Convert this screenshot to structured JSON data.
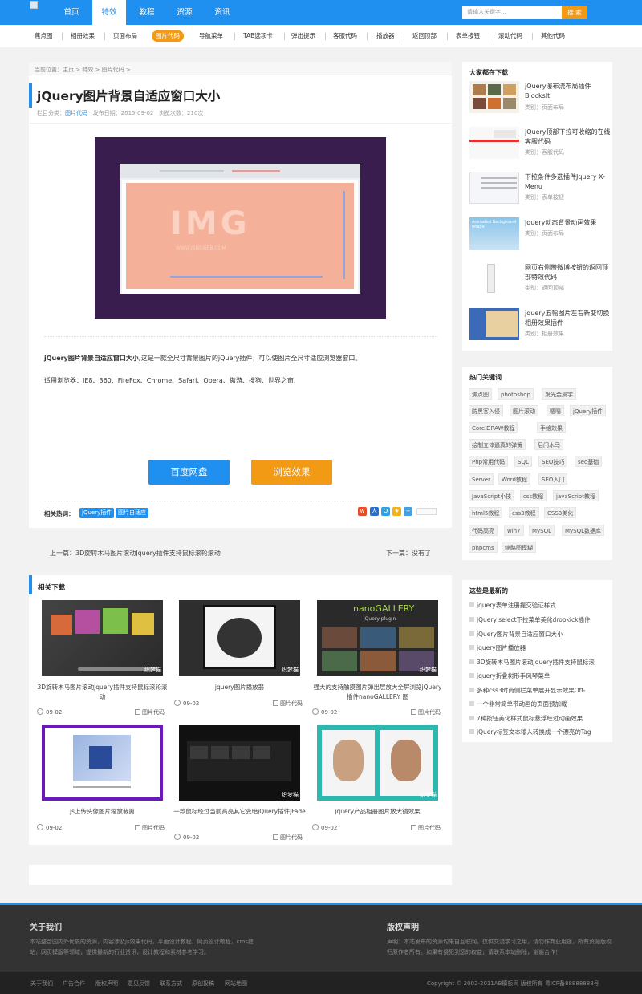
{
  "nav": {
    "items": [
      "首页",
      "特效",
      "教程",
      "资源",
      "资讯"
    ],
    "active": "特效"
  },
  "search": {
    "placeholder": "请输入关键字...",
    "button": "搜 索"
  },
  "subnav": [
    "焦点图",
    "相册效果",
    "页面布局",
    "图片代码",
    "导航菜单",
    "TAB选项卡",
    "弹出提示",
    "客服代码",
    "播放器",
    "返回顶部",
    "表单按钮",
    "滚动代码",
    "其他代码"
  ],
  "breadcrumb": "当前位置：主页 > 特效 > 图片代码 >",
  "article": {
    "title": "jQuery图片背景自适应窗口大小",
    "meta_prefix": "栏目分类：",
    "meta_category": "图片代码",
    "meta_date": "发布日期：2015-09-02",
    "meta_views": "浏览次数：210次",
    "image_text": "IMG",
    "image_sub": "WWW.JSNEWEB.COM",
    "lead_bold": "jQuery图片背景自适应窗口大小,",
    "lead_rest": "这是一款全尺寸背景图片的jQuery插件，可以使图片全尺寸适应浏览器窗口。",
    "browsers": "适用浏览器：IE8、360、FireFox、Chrome、Safari、Opera、傲游、搜狗、世界之窗.",
    "btn_baidu": "百度网盘",
    "btn_demo": "浏览效果",
    "tags_label": "相关热词：",
    "tags": [
      "jQuery插件",
      "图片自适应"
    ],
    "prev": "上一篇：3D旋转木马图片滚动Jquery插件支持鼠标滚轮滚动",
    "next": "下一篇：没有了"
  },
  "related": {
    "title": "相关下载",
    "items": [
      {
        "title": "3D旋转木马图片滚动Jquery插件支持鼠标滚轮滚动",
        "date": "09-02",
        "cat": "图片代码",
        "wm": "织梦猫"
      },
      {
        "title": "jquery图片播放器",
        "date": "09-02",
        "cat": "图片代码",
        "wm": "织梦猫"
      },
      {
        "title": "强大的支持触摸图片弹出层放大全屏浏览jQuery插件nanoGALLERY 图",
        "date": "09-02",
        "cat": "图片代码",
        "wm": "织梦猫",
        "img_title": "nanoGALLERY",
        "img_sub": "jQuery plugin"
      },
      {
        "title": "js上传头像图片缩放裁剪",
        "date": "09-02",
        "cat": "图片代码",
        "wm": "织梦猫"
      },
      {
        "title": "一款鼠标经过当前高亮其它变暗jQuery插件jFade",
        "date": "09-02",
        "cat": "图片代码",
        "wm": "织梦猫"
      },
      {
        "title": "jquery产品相册图片放大镜效果",
        "date": "09-02",
        "cat": "图片代码",
        "wm": "织梦猫"
      }
    ]
  },
  "sidebar": {
    "downloads_title": "大家都在下载",
    "downloads": [
      {
        "title": "jQuery瀑布流布局插件BlocksIt",
        "cat": "类别：页面布局"
      },
      {
        "title": "jQuery顶部下拉可收缩的在线客服代码",
        "cat": "类别：客服代码"
      },
      {
        "title": "下拉条件多选插件Jquery X-Menu",
        "cat": "类别：表单按钮"
      },
      {
        "title": "jquery动态背景动画效果",
        "cat": "类别：页面布局",
        "img_label": "Animated Background Image"
      },
      {
        "title": "网页右侧带微博按钮的返回顶部特效代码",
        "cat": "类别：返回顶部"
      },
      {
        "title": "jquery五幅图片左右新变切换相册效果插件",
        "cat": "类别：相册效果"
      }
    ],
    "keywords_title": "热门关键词",
    "keywords": [
      "焦点图",
      "photoshop",
      "发光金属字",
      "防黑客入侵",
      "图片滚动",
      "嗯嗯",
      "jQuery插件",
      "CorelDRAW教程",
      "手绘效果",
      "绘制立体逼真的弹簧",
      "后门木马",
      "Php常用代码",
      "SQL",
      "SEO技巧",
      "seo基础",
      "Server",
      "Word教程",
      "SEO入门",
      "JavaScript小技",
      "css教程",
      "javaScript教程",
      "html5教程",
      "css3教程",
      "CSS3美化",
      "代码高亮",
      "win7",
      "MySQL",
      "MySQL数据库",
      "phpcms",
      "缩略图模糊"
    ],
    "recent_title": "这些是最新的",
    "recent": [
      "jquery表单注册提交验证样式",
      "jQuery select下拉菜单美化dropkick插件",
      "jQuery图片背景自适应窗口大小",
      "jquery图片播放器",
      "3D旋转木马图片滚动Jquery插件支持鼠标滚",
      "jquery折叠树形手风琴菜单",
      "多种css3时尚侧栏菜单展开显示效果Off-",
      "一个非常简单带动画的页面预加载",
      "7种按钮美化样式鼠标悬浮经过动画效果",
      "jQuery标签文本输入转换成一个漂亮的Tag"
    ]
  },
  "footer": {
    "about_title": "关于我们",
    "about_text": "本站整合国内外优质的资源，内容涉及js效果代码，平面设计教程，网页设计教程，cms建站，网页模版等领域，提供最新的行业资讯，设计教程和素材参考学习。",
    "copyright_title": "版权声明",
    "copyright_text": "声明：本站发布的资源均来自互联网，仅供交流学习之用，请勿作商业用途，所有资源版权归原作者所有。如果有侵犯到您的权益，请联系本站删除，谢谢合作！",
    "links": [
      "关于我们",
      "广告合作",
      "版权声明",
      "意见反馈",
      "联系方式",
      "原创投稿",
      "网站地图"
    ],
    "copyright": "Copyright © 2002-2011AB模板网 版权所有   粤ICP备88888888号"
  },
  "colors": {
    "primary": "#1f8ff0",
    "accent": "#f39a14"
  }
}
